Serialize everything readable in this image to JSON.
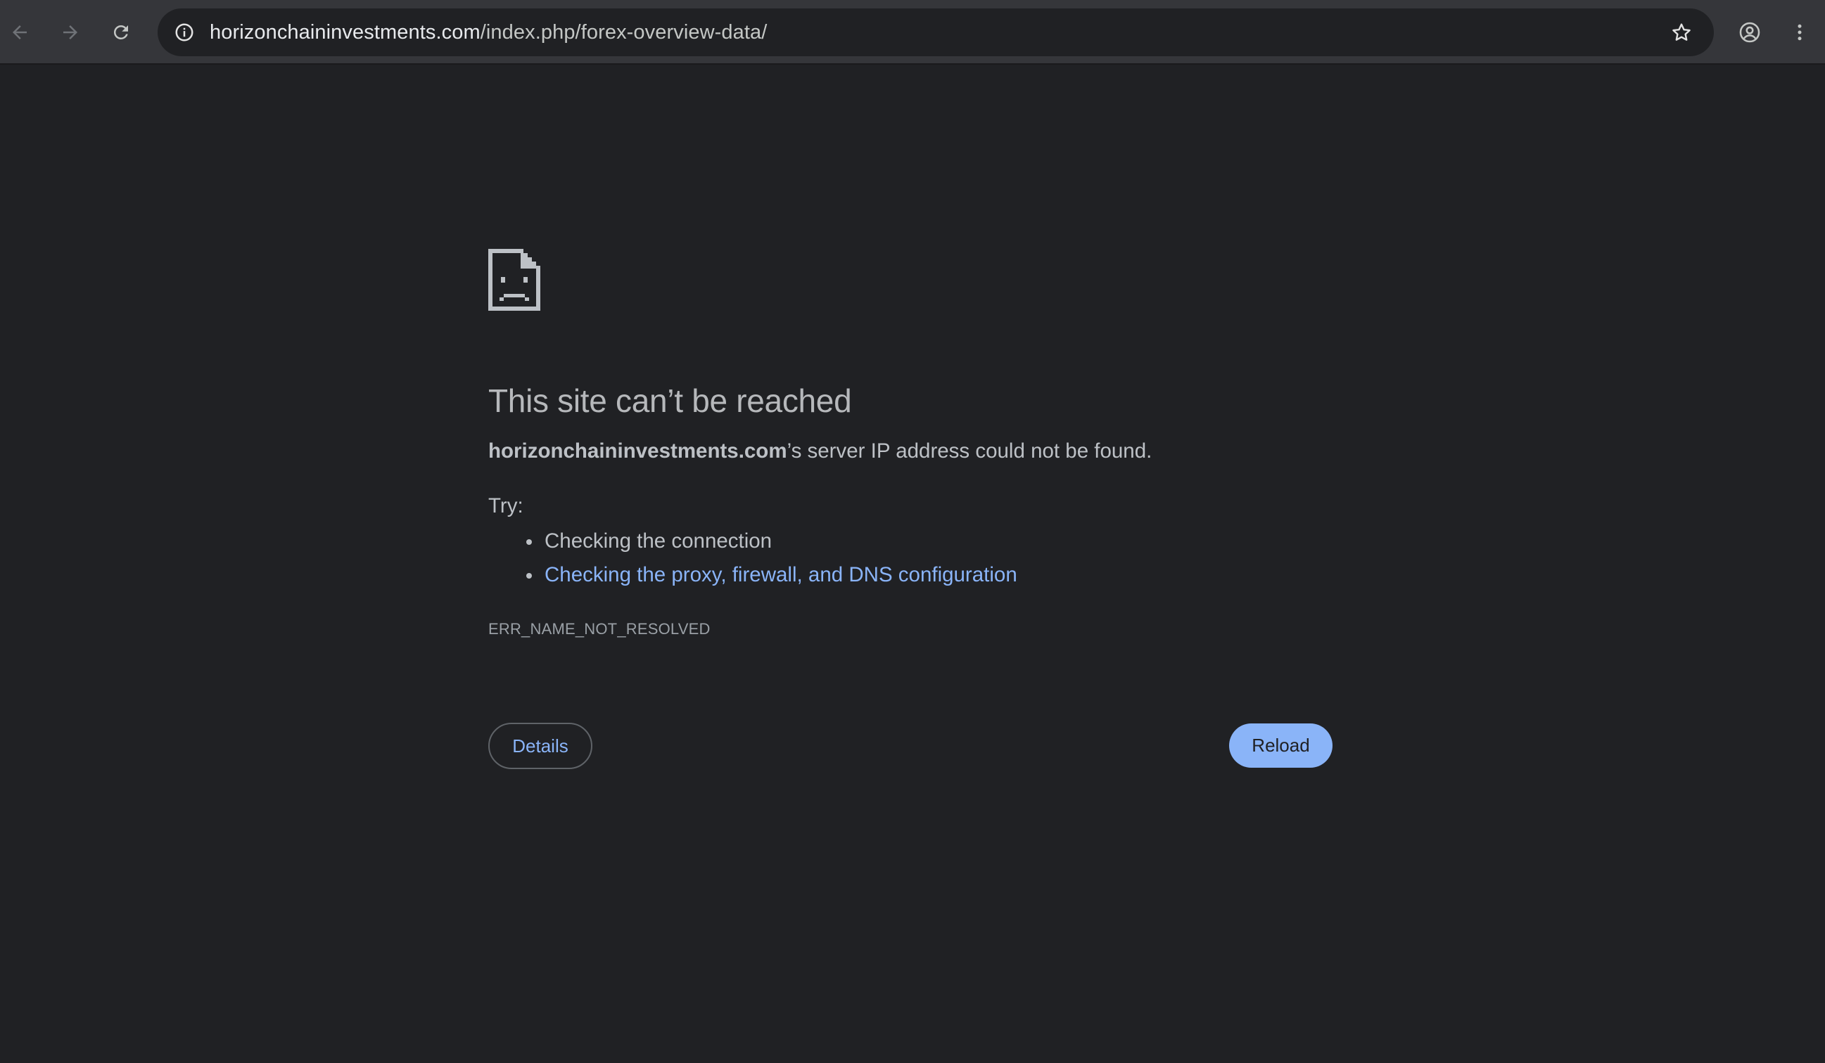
{
  "browser": {
    "url_host": "horizonchaininvestments.com",
    "url_path": "/index.php/forex-overview-data/",
    "icons": {
      "back": "arrow-left-icon",
      "forward": "arrow-right-icon",
      "reload": "reload-icon",
      "site_info": "info-circle-icon",
      "bookmark": "star-icon",
      "profile": "account-circle-icon",
      "menu": "three-dot-vertical-icon"
    }
  },
  "error_page": {
    "icon": "sad-document-icon",
    "heading": "This site can’t be reached",
    "host": "horizonchaininvestments.com",
    "summary_suffix": "’s server IP address could not be found.",
    "try_label": "Try:",
    "suggestions": [
      "Checking the connection",
      "Checking the proxy, firewall, and DNS configuration"
    ],
    "error_code": "ERR_NAME_NOT_RESOLVED",
    "details_button": "Details",
    "reload_button": "Reload"
  },
  "colors": {
    "page_background": "#202124",
    "toolbar_background": "#35363a",
    "link": "#8ab4f8",
    "primary_button": "#8ab4f8",
    "text": "#bdc1c6"
  }
}
